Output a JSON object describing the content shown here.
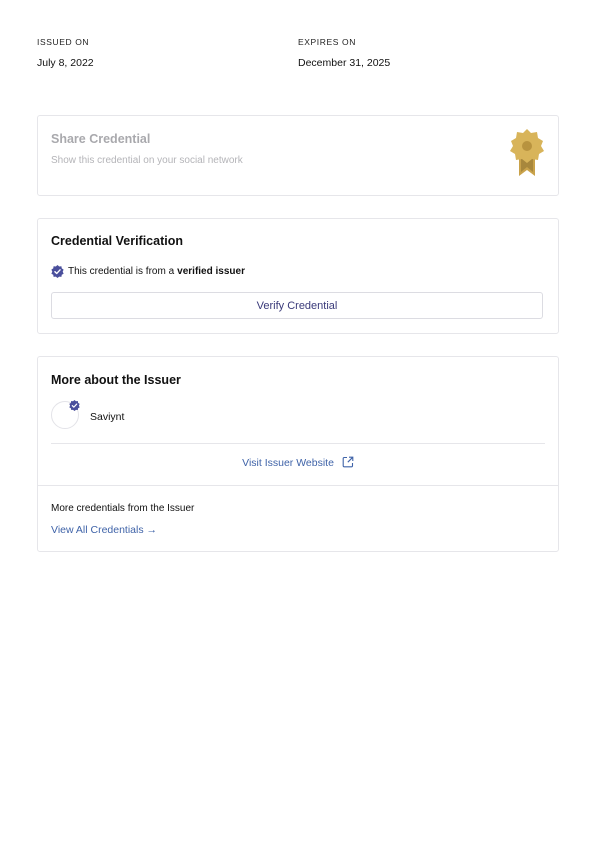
{
  "dates": {
    "issued_label": "ISSUED ON",
    "issued_value": "July 8, 2022",
    "expires_label": "EXPIRES ON",
    "expires_value": "December 31, 2025"
  },
  "share": {
    "title": "Share Credential",
    "subtitle": "Show this credential on your social network",
    "icon": "award-badge-icon"
  },
  "verification": {
    "title": "Credential Verification",
    "text_prefix": "This credential is from a",
    "text_bold": "verified issuer",
    "button_label": "Verify Credential"
  },
  "issuer": {
    "title": "More about the Issuer",
    "name": "Saviynt",
    "website_link": "Visit Issuer Website",
    "more_text": "More credentials from the Issuer",
    "view_all_link": "View All Credentials →"
  },
  "colors": {
    "link": "#3f63a8",
    "verified_check": "#4a4f9c",
    "badge_gold": "#d8b45a",
    "muted_text": "#a9a9ad"
  }
}
